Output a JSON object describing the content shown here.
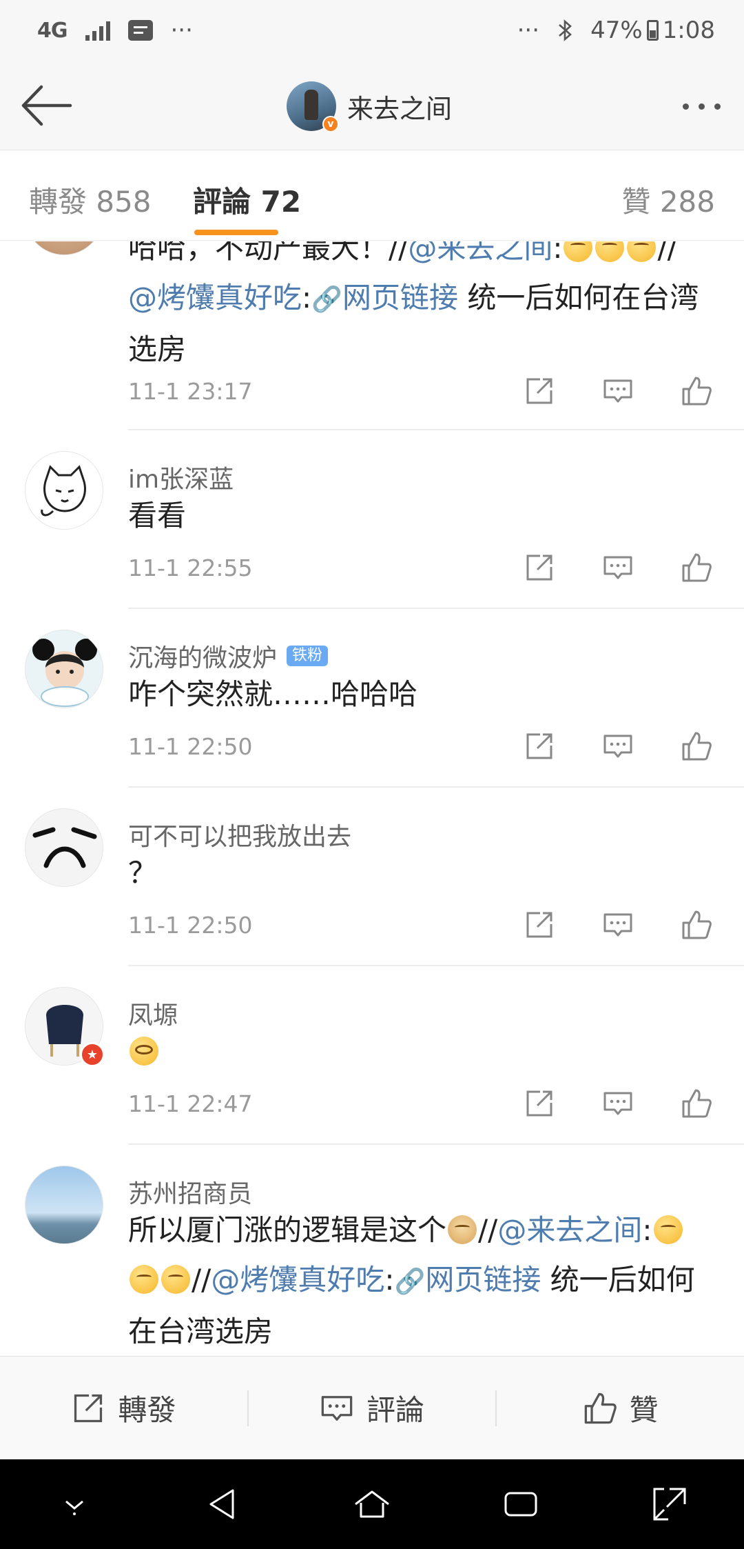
{
  "status_bar": {
    "network": "4G",
    "dots_left": "···",
    "dots_right": "···",
    "battery": "47%",
    "time": "1:08"
  },
  "nav": {
    "title": "来去之间",
    "verified_badge": "v"
  },
  "tabs": {
    "repost": "轉發 858",
    "comments": "評論 72",
    "likes": "贊 288"
  },
  "comments": [
    {
      "user": "",
      "time": "11-1 23:17",
      "parts": [
        "哈哈，不动产最大！//",
        "@来去之间",
        ":",
        "//",
        "@烤馕真好吃",
        ":",
        "网页链接",
        " 统一后如何在台湾选房"
      ]
    },
    {
      "user": "im张深蓝",
      "text": "看看",
      "time": "11-1 22:55"
    },
    {
      "user": "沉海的微波炉",
      "badge": "铁粉",
      "text": "咋个突然就……哈哈哈",
      "time": "11-1 22:50"
    },
    {
      "user": "可不可以把我放出去",
      "text": "？",
      "time": "11-1 22:50"
    },
    {
      "user": "凤塬",
      "text": "",
      "time": "11-1 22:47"
    },
    {
      "user": "苏州招商员",
      "time": "",
      "parts": [
        "所以厦门涨的逻辑是这个",
        "//",
        "@来去之间",
        ":",
        "//",
        "@烤馕真好吃",
        ":",
        "网页链接",
        " 统一后如何在台湾选房"
      ]
    }
  ],
  "bottom_bar": {
    "repost": "轉發",
    "comment": "評論",
    "like": "贊"
  },
  "icons": {
    "back": "arrow-left-icon",
    "more": "more-dots-icon",
    "share": "share-icon",
    "comment": "comment-icon",
    "like": "thumbs-up-icon",
    "link": "link-icon"
  },
  "colors": {
    "accent": "#f7931e",
    "link": "#4f7cae",
    "fan_badge": "#6aaaf2",
    "verified": "#f5821f"
  }
}
